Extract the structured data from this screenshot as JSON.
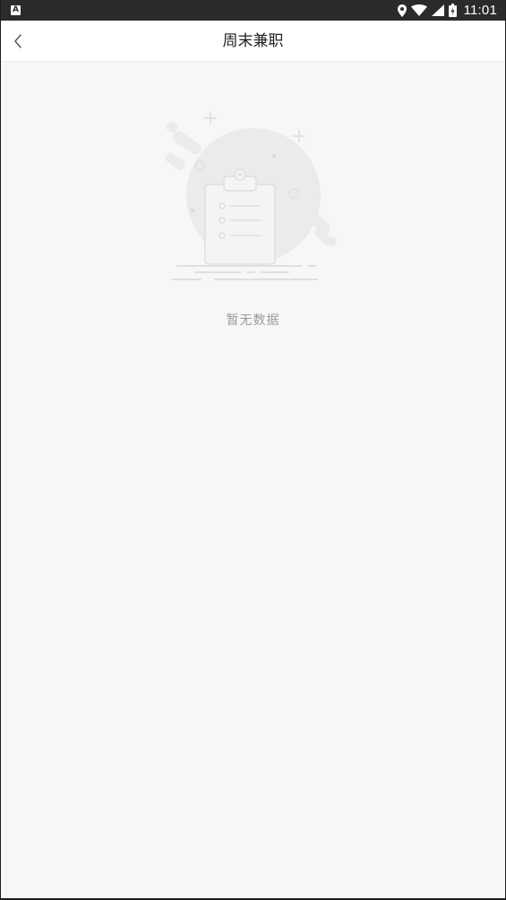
{
  "status_bar": {
    "app_icon_letter": "A",
    "time": "11:01",
    "icons": [
      "location-icon",
      "wifi-icon",
      "signal-icon",
      "battery-icon"
    ]
  },
  "header": {
    "back_icon": "chevron-left-icon",
    "title": "周末兼职"
  },
  "empty_state": {
    "illustration": "empty-clipboard-icon",
    "message": "暂无数据"
  },
  "colors": {
    "status_bar_bg": "#2b2b2b",
    "header_bg": "#ffffff",
    "page_bg": "#f6f7f9",
    "title_text": "#222222",
    "empty_text": "#9a9a9a",
    "illustration_gray": "#ebebeb"
  }
}
